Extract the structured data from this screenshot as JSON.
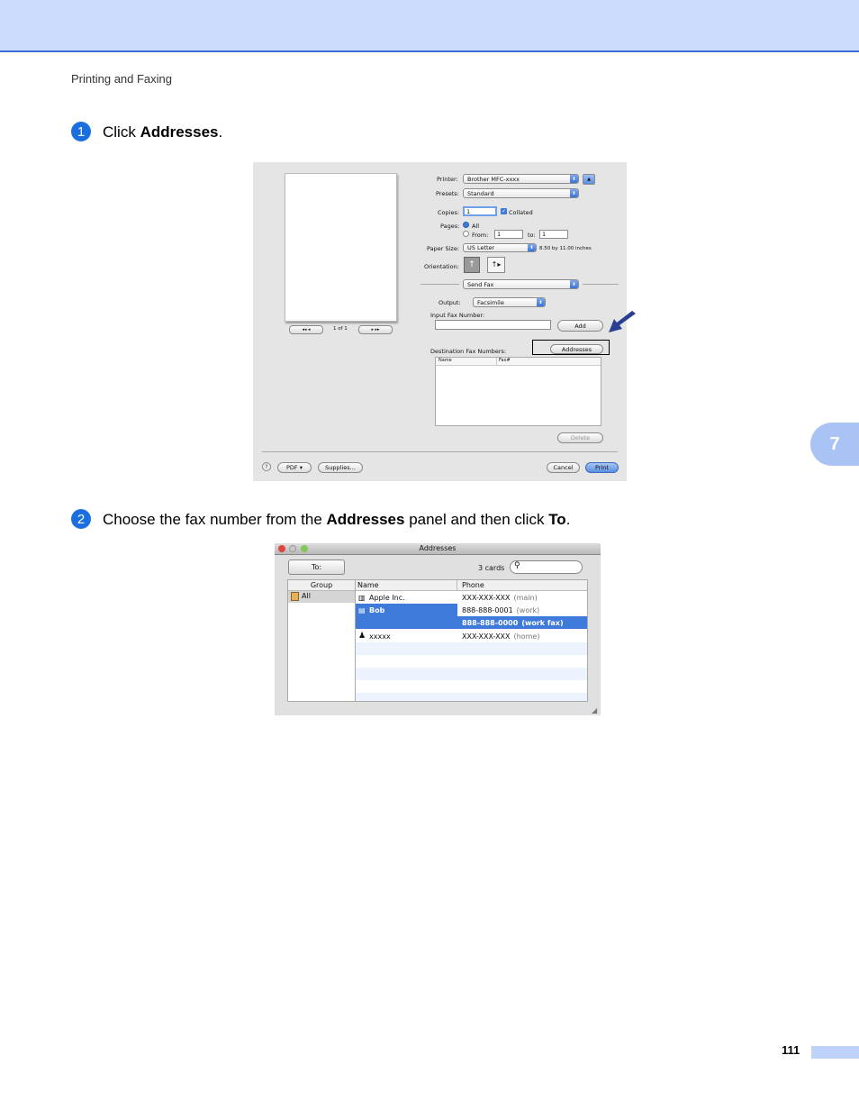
{
  "header": {
    "running_title": "Printing and Faxing"
  },
  "chapter_tab": "7",
  "page_number": "111",
  "steps": [
    {
      "number": "1",
      "prefix": "Click ",
      "bold1": "Addresses",
      "suffix": "."
    },
    {
      "number": "2",
      "prefix": "Choose the fax number from the ",
      "bold1": "Addresses",
      "middle": " panel and then click ",
      "bold2": "To",
      "suffix": "."
    }
  ],
  "print_dialog": {
    "printer_label": "Printer:",
    "printer_value": "Brother MFC-xxxx",
    "presets_label": "Presets:",
    "presets_value": "Standard",
    "copies_label": "Copies:",
    "copies_value": "1",
    "collated_label": "Collated",
    "pages_label": "Pages:",
    "pages_all": "All",
    "pages_from": "From:",
    "pages_from_value": "1",
    "pages_to": "to:",
    "pages_to_value": "1",
    "paper_size_label": "Paper Size:",
    "paper_size_value": "US Letter",
    "paper_size_dims": "8.50 by 11.00 inches",
    "orientation_label": "Orientation:",
    "section_value": "Send Fax",
    "output_label": "Output:",
    "output_value": "Facsimile",
    "input_fax_label": "Input Fax Number:",
    "input_fax_value": "",
    "add_button": "Add",
    "destination_label": "Destination Fax Numbers:",
    "addresses_button": "Addresses",
    "table_headers": [
      "Name",
      "Fax#"
    ],
    "delete_button": "Delete",
    "preview_nav": {
      "first_prev": "◂◂  ◂",
      "page_indicator": "1 of 1",
      "next_last": "▸  ▸▸"
    },
    "help_icon": "?",
    "pdf_button": "PDF ▾",
    "supplies_button": "Supplies...",
    "cancel_button": "Cancel",
    "print_button": "Print"
  },
  "addresses_window": {
    "title": "Addresses",
    "to_button": "To:",
    "card_count": "3 cards",
    "search_placeholder": "",
    "group_header": "Group",
    "name_header": "Name",
    "phone_header": "Phone",
    "groups": [
      "All"
    ],
    "contacts": [
      {
        "name": "Apple Inc.",
        "phone": "XXX-XXX-XXX",
        "phone_type": "(main)"
      },
      {
        "name": "Bob",
        "phone": "888-888-0001",
        "phone_type": "(work)"
      },
      {
        "name": "",
        "phone": "888-888-0000",
        "phone_type": "(work fax)"
      },
      {
        "name": "xxxxx",
        "phone": "XXX-XXX-XXX",
        "phone_type": "(home)"
      }
    ]
  },
  "colors": {
    "header_band": "#ccdcfc",
    "accent": "#3f6fd8",
    "step_bullet": "#1a6fe0",
    "selection": "#3d7ad9",
    "arrow": "#2a3f8f"
  }
}
